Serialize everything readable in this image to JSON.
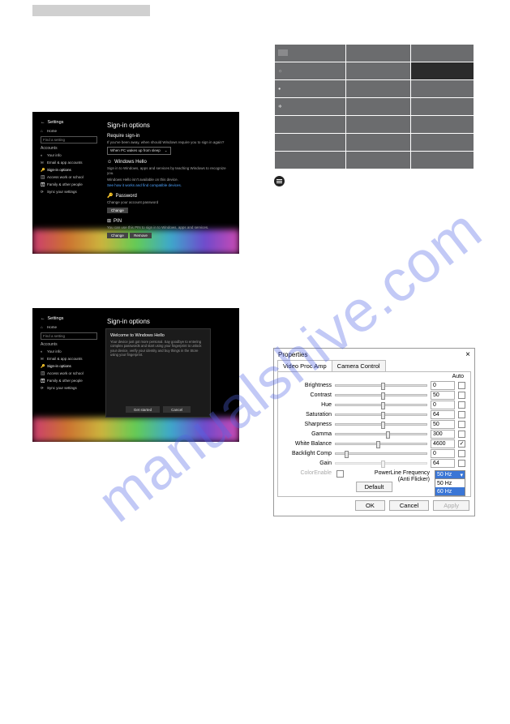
{
  "watermark": "manualshive.com",
  "signin": {
    "back": "←",
    "title_app": "Settings",
    "search_ph": "Find a setting",
    "nav_home": "Home",
    "section": "Accounts",
    "items": [
      "Your info",
      "Email & app accounts",
      "Sign-in options",
      "Access work or school",
      "Family & other people",
      "Sync your settings"
    ],
    "page_title": "Sign-in options",
    "require_h": "Require sign-in",
    "require_p": "If you've been away, when should Windows require you to sign in again?",
    "require_sel": "When PC wakes up from sleep",
    "hello_h": "Windows Hello",
    "hello_icon_alt": "face-icon",
    "hello_p1": "Sign in to Windows, apps and services by teaching Windows to recognize you.",
    "hello_p2": "Windows Hello isn't available on this device.",
    "hello_link": "See how it works and find compatible devices.",
    "pw_h": "Password",
    "pw_icon_alt": "key-icon",
    "pw_p": "Change your account password",
    "pw_btn": "Change",
    "pin_h": "PIN",
    "pin_icon_alt": "grid-icon",
    "pin_p": "You can use this PIN to sign in to Windows, apps and services.",
    "pin_btn1": "Change",
    "pin_btn2": "Remove",
    "popup": {
      "title": "Welcome to Windows Hello",
      "p": "Your device just got more personal. Say goodbye to entering complex passwords and start using your fingerprint to unlock your device, verify your identity and buy things in the Store using your fingerprint.",
      "btn1": "Get started",
      "btn2": "Cancel"
    }
  },
  "settings_table": {
    "rows": [
      {
        "icon": "sq",
        "label": ""
      },
      {
        "icon": "sun",
        "label": ""
      },
      {
        "icon": "cam",
        "label": ""
      },
      {
        "icon": "gear",
        "label": ""
      }
    ]
  },
  "props": {
    "title": "Properties",
    "close": "×",
    "tab1": "Video Proc Amp",
    "tab2": "Camera Control",
    "auto": "Auto",
    "rows": [
      {
        "label": "Brightness",
        "val": "0",
        "pos": 50,
        "check": false,
        "dis": false
      },
      {
        "label": "Contrast",
        "val": "50",
        "pos": 50,
        "check": false,
        "dis": false
      },
      {
        "label": "Hue",
        "val": "0",
        "pos": 50,
        "check": false,
        "dis": false
      },
      {
        "label": "Saturation",
        "val": "64",
        "pos": 50,
        "check": false,
        "dis": false
      },
      {
        "label": "Sharpness",
        "val": "50",
        "pos": 50,
        "check": false,
        "dis": false
      },
      {
        "label": "Gamma",
        "val": "300",
        "pos": 55,
        "check": false,
        "dis": false
      },
      {
        "label": "White Balance",
        "val": "4600",
        "pos": 45,
        "check": true,
        "dis": false
      },
      {
        "label": "Backlight Comp",
        "val": "0",
        "pos": 10,
        "check": false,
        "dis": false
      },
      {
        "label": "Gain",
        "val": "64",
        "pos": 50,
        "check": false,
        "dis": true
      }
    ],
    "color_enable": "ColorEnable",
    "plfreq_label": "PowerLine Frequency\n(Anti Flicker)",
    "plfreq_sel": "50 Hz",
    "plfreq_opts": [
      "50 Hz",
      "60 Hz"
    ],
    "default_btn": "Default",
    "ok": "OK",
    "cancel": "Cancel",
    "apply": "Apply"
  }
}
